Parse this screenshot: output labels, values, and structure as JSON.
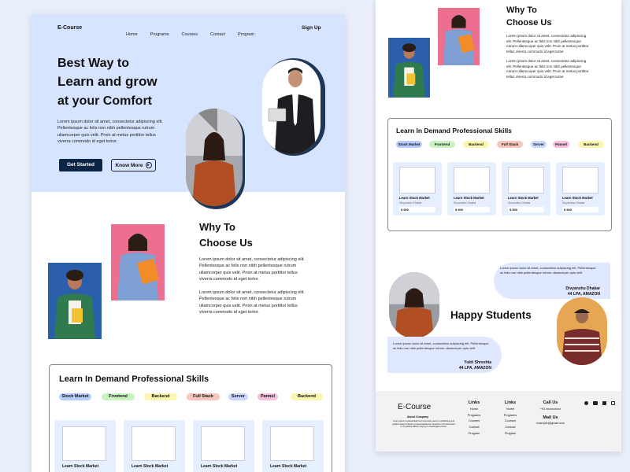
{
  "brand": "E-Course",
  "nav": [
    "Home",
    "Programs",
    "Courses",
    "Contact",
    "Program"
  ],
  "signup": "Sign Up",
  "hero": {
    "line1": "Best Way to",
    "line2": "Learn and grow",
    "line3": "at your Comfort",
    "para": "Lorem ipsum dolor sit amet, consectetur adipiscing elit. Pellentesque ac felis non nibh pellentesque rutrum ullamcorper quis velit. Proin at metus porttitor tellus viverra commodo id eget tortor.",
    "cta1": "Get Started",
    "cta2": "Know More"
  },
  "why": {
    "line1": "Why To",
    "line2": "Choose Us",
    "para1": "Lorem ipsum dolor sit amet, consectetur adipiscing elit. Pellentesque ac felis non nibh pellentesque rutrum ullamcorper quis velit. Proin at metus porttitor tellus viverra commodo id eget tortor.",
    "para2": "Lorem ipsum dolor sit amet, consectetur adipiscing elit. Pellentesque ac felis non nibh pellentesque rutrum ullamcorper quis velit. Proin at metus porttitor tellus viverra commodo id eget tortor."
  },
  "skills": {
    "title": "Learn In Demand Professional Skills",
    "tags": [
      {
        "label": "Stock Market",
        "color": "#b8ccff"
      },
      {
        "label": "Frontend",
        "color": "#c9f4bf"
      },
      {
        "label": "Backend",
        "color": "#fbf7b0"
      },
      {
        "label": "Full Stack",
        "color": "#f7c7bd"
      },
      {
        "label": "Server",
        "color": "#c7d7ff"
      },
      {
        "label": "Pannel",
        "color": "#f6c1dc"
      },
      {
        "label": "Backend",
        "color": "#fbf7b0"
      }
    ],
    "course_title": "Learn Stock Market",
    "course_author": "Divyanshu Dhakar",
    "course_price": "$ 500"
  },
  "students": {
    "title": "Happy Students",
    "quote": "Lorem ipsum dolor sit amet, consectetur adipiscing elit. Pellentesque ac felis non nibh pellentesque rutrum ullamcorper quis velit.",
    "s1_name": "Divyanshu Dhakar",
    "s1_role": "44 LPA, AMAZON",
    "s2_name": "Yukti Shreshta",
    "s2_role": "44 LPA, AMAZON"
  },
  "footer": {
    "brand": "E-Course",
    "about_head": "About Company",
    "about": "Lorem ipsum is placeholder text commonly used in a publishing and graphic design industry to demonstrate the visual form of a document or a typeface without relying on meaningful content.",
    "links_head": "Links",
    "links": [
      "Home",
      "Programs",
      "Courses",
      "Contact",
      "Program"
    ],
    "call_head": "Call Us",
    "phone": "+91 xxxxxxxxxx",
    "mail_head": "Mail Us",
    "email": "example@gmail.com"
  }
}
